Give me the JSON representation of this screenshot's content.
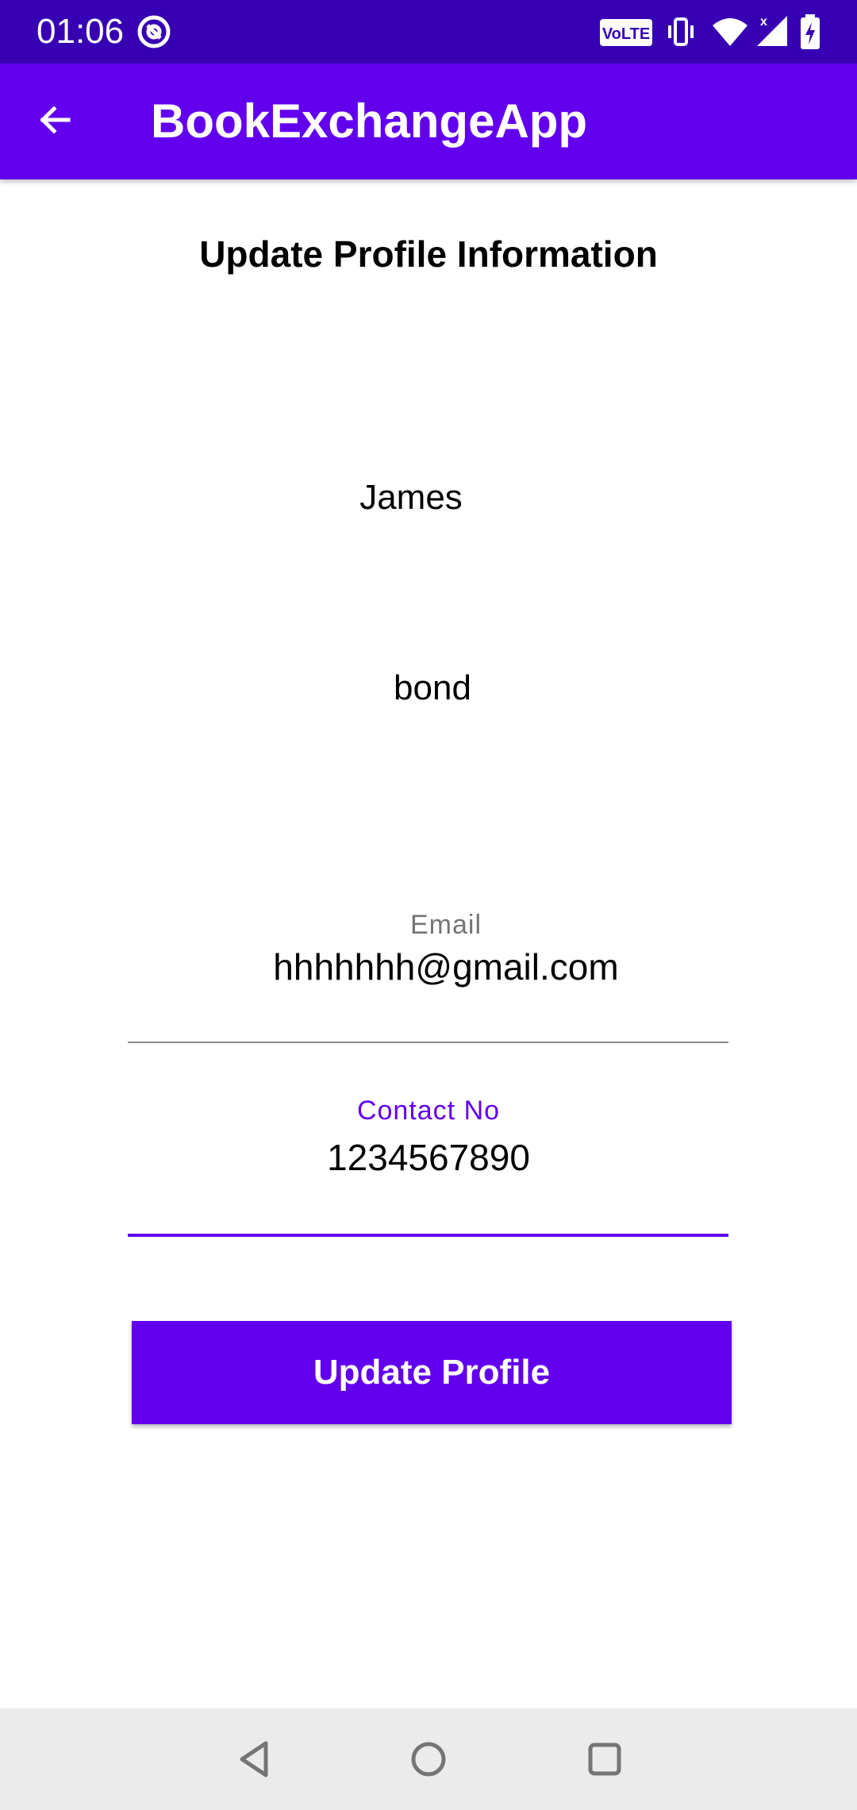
{
  "status_bar": {
    "time": "01:06",
    "volte_label": "VoLTE",
    "icons": [
      "at-sign-icon",
      "volte-icon",
      "vibrate-icon",
      "wifi-icon",
      "signal-icon",
      "battery-charging-icon"
    ]
  },
  "app_bar": {
    "title": "BookExchangeApp",
    "back_icon": "arrow-left-icon"
  },
  "page": {
    "title": "Update Profile Information",
    "first_name": "James",
    "last_name": "bond"
  },
  "form": {
    "email": {
      "label": "Email",
      "value": "hhhhhhh@gmail.com"
    },
    "contact": {
      "label": "Contact No",
      "value": "1234567890"
    },
    "submit_label": "Update Profile"
  },
  "nav_bar": {
    "icons": [
      "back-triangle-icon",
      "home-circle-icon",
      "recents-square-icon"
    ]
  },
  "colors": {
    "primary": "#6200EE",
    "primary_dark": "#3700B3",
    "label_inactive": "#757575",
    "label_active": "#6200EE"
  }
}
